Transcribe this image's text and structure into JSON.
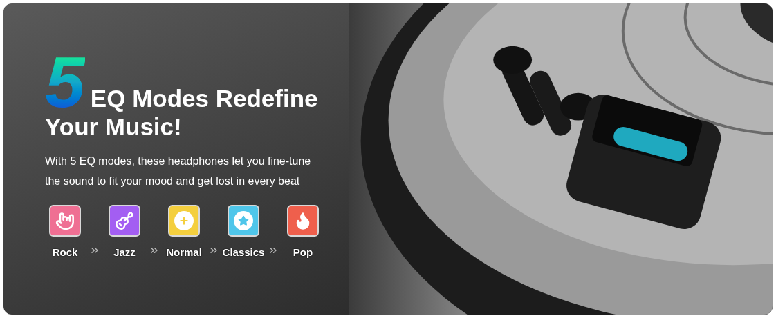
{
  "banner": {
    "headline": {
      "number": "5",
      "line_1": "EQ Modes Redefine",
      "line_2": "Your Music!"
    },
    "description": "With 5 EQ modes, these headphones let you fine-tune the sound to fit your mood and get lost in every beat",
    "modes": [
      {
        "label": "Rock",
        "color": "#ef6f93"
      },
      {
        "label": "Jazz",
        "color": "#a35ef2"
      },
      {
        "label": "Normal",
        "color": "#f4cf3e"
      },
      {
        "label": "Classics",
        "color": "#4fc6ea"
      },
      {
        "label": "Pop",
        "color": "#ef5f4c"
      }
    ]
  }
}
